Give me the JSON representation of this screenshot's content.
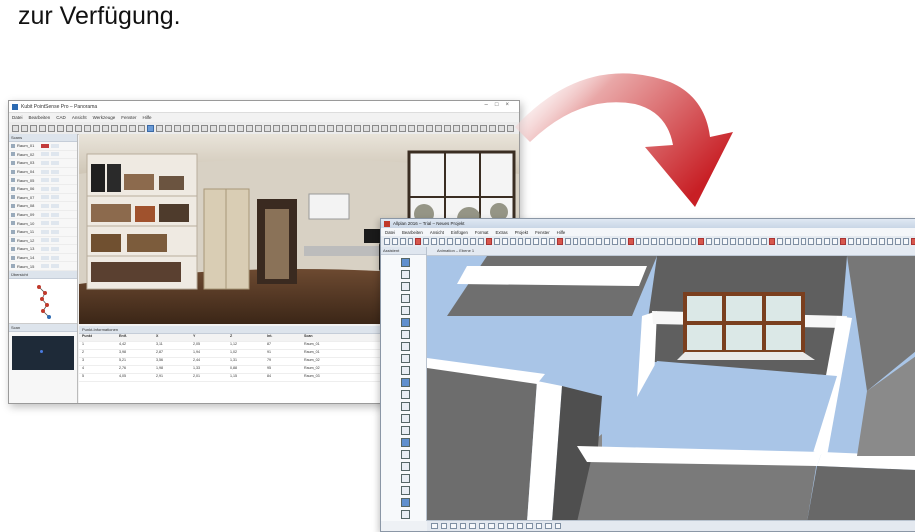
{
  "caption": "zur Verfügung.",
  "window1": {
    "title": "Kubit PointSense Pro – Panorama",
    "menu": [
      "Datei",
      "Bearbeiten",
      "CAD",
      "Ansicht",
      "Werkzeuge",
      "Fenster",
      "Hilfe"
    ],
    "scans_panel_title": "Scans",
    "scans": [
      "Raum_01",
      "Raum_02",
      "Raum_03",
      "Raum_04",
      "Raum_05",
      "Raum_06",
      "Raum_07",
      "Raum_08",
      "Raum_09",
      "Raum_10",
      "Raum_11",
      "Raum_12",
      "Raum_13",
      "Raum_14",
      "Raum_15"
    ],
    "overview_title": "Übersicht",
    "scan_info_title": "Scan",
    "table_title": "Punkt-Informationen",
    "table_headers": [
      "Punkt",
      "Entf.",
      "X",
      "Y",
      "Z",
      "Int.",
      "Scan"
    ],
    "table_rows": [
      [
        "1",
        "4,42",
        "3,11",
        "2,05",
        "1,12",
        "87",
        "Raum_01"
      ],
      [
        "2",
        "3,98",
        "2,87",
        "1,94",
        "1,02",
        "91",
        "Raum_01"
      ],
      [
        "3",
        "5,21",
        "3,56",
        "2,44",
        "1,31",
        "79",
        "Raum_02"
      ],
      [
        "4",
        "2,76",
        "1,98",
        "1,33",
        "0,88",
        "95",
        "Raum_02"
      ],
      [
        "5",
        "4,05",
        "2,91",
        "2,01",
        "1,15",
        "84",
        "Raum_03"
      ]
    ]
  },
  "window2": {
    "title": "Allplan 2016 – Trial – Neues Projekt",
    "menu": [
      "Datei",
      "Bearbeiten",
      "Ansicht",
      "Einfügen",
      "Format",
      "Extras",
      "Projekt",
      "Fenster",
      "Hilfe"
    ],
    "left_panel_title": "Assistent",
    "view_title": "Animation – Ebene 1"
  },
  "colors": {
    "arrow": "#d0242a",
    "floor": "#aac6e8",
    "wall": "#6f6f6f",
    "wall_top": "#ffffff",
    "window_frame": "#7a3f1f"
  }
}
